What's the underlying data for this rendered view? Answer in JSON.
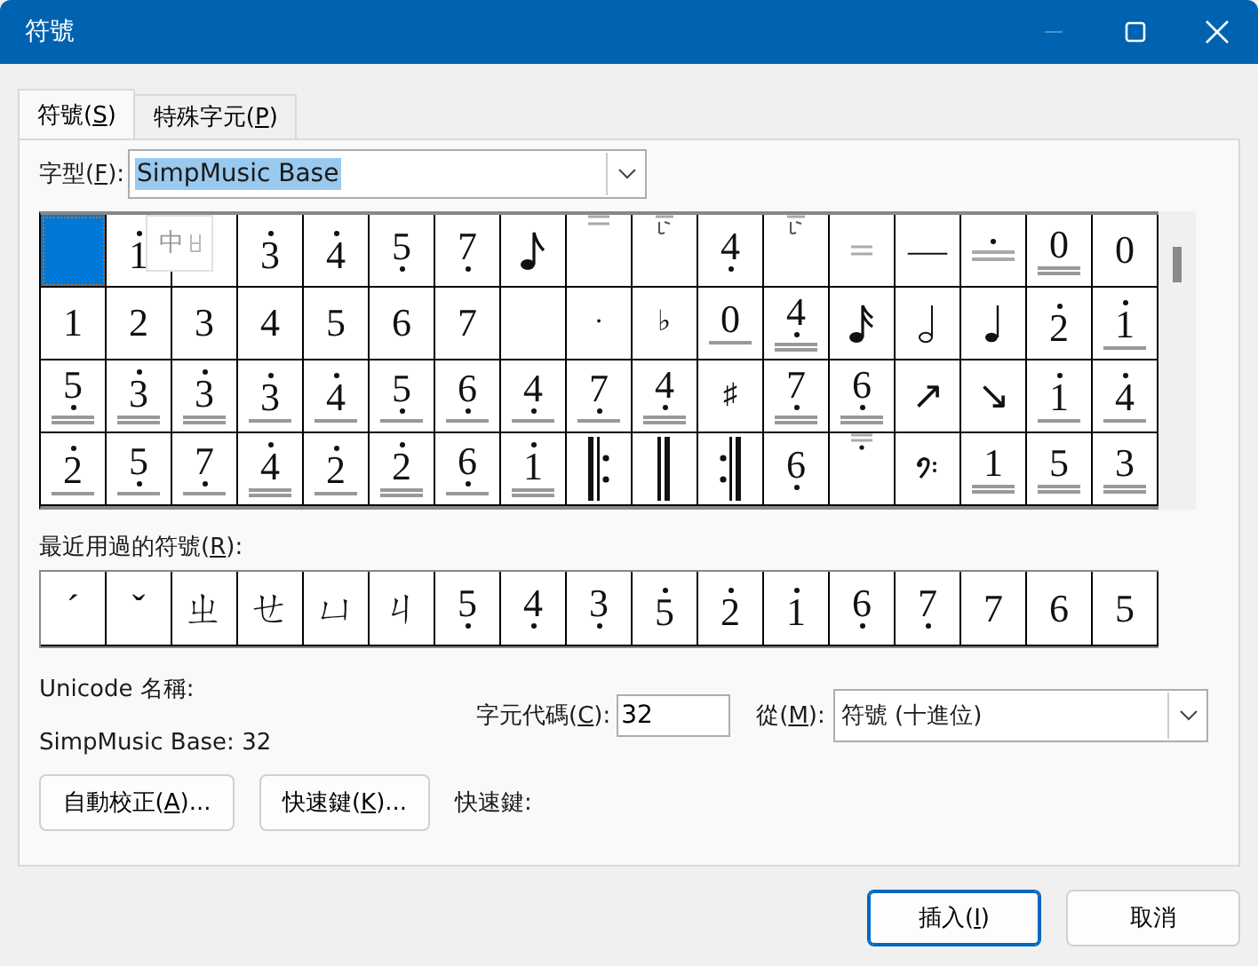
{
  "window": {
    "title": "符號"
  },
  "tabs": [
    {
      "before": "符號(",
      "key": "S",
      "after": ")",
      "selected": true
    },
    {
      "before": "特殊字元(",
      "key": "P",
      "after": ")",
      "selected": false
    }
  ],
  "font": {
    "before": "字型(",
    "key": "F",
    "after": "):",
    "value": "SimpMusic Base",
    "highlighted": true
  },
  "ime_indicator": {
    "text": "中"
  },
  "symbols": [
    {
      "kind": "blank",
      "selected": true
    },
    {
      "kind": "digit",
      "text": "1",
      "above": true,
      "below": false,
      "underline": false,
      "selected": false
    },
    {
      "kind": "blank",
      "selected": false
    },
    {
      "kind": "digit",
      "text": "3",
      "above": true,
      "below": false,
      "underline": false,
      "selected": false
    },
    {
      "kind": "digit",
      "text": "4",
      "above": true,
      "below": false,
      "underline": false,
      "selected": false
    },
    {
      "kind": "digit",
      "text": "5",
      "above": false,
      "below": true,
      "underline": false,
      "selected": false
    },
    {
      "kind": "digit",
      "text": "7",
      "above": false,
      "below": true,
      "underline": false,
      "selected": false
    },
    {
      "kind": "eighth-note",
      "selected": false
    },
    {
      "kind": "top-double",
      "selected": false
    },
    {
      "kind": "tie-mark",
      "selected": false
    },
    {
      "kind": "digit",
      "text": "4",
      "above": false,
      "below": true,
      "underline": false,
      "selected": false
    },
    {
      "kind": "tie-mark",
      "selected": false
    },
    {
      "kind": "bottom-double",
      "selected": false
    },
    {
      "kind": "glyph",
      "text": "—",
      "selected": false
    },
    {
      "kind": "dot-underline",
      "selected": false
    },
    {
      "kind": "digit",
      "text": "0",
      "above": false,
      "below": false,
      "underline": true,
      "double_line": true,
      "selected": false
    },
    {
      "kind": "digit",
      "text": "0",
      "above": false,
      "below": false,
      "underline": false,
      "selected": false
    },
    {
      "kind": "digit",
      "text": "1",
      "above": false,
      "below": false,
      "underline": false,
      "selected": false
    },
    {
      "kind": "digit",
      "text": "2",
      "above": false,
      "below": false,
      "underline": false,
      "selected": false
    },
    {
      "kind": "digit",
      "text": "3",
      "above": false,
      "below": false,
      "underline": false,
      "selected": false
    },
    {
      "kind": "digit",
      "text": "4",
      "above": false,
      "below": false,
      "underline": false,
      "selected": false
    },
    {
      "kind": "digit",
      "text": "5",
      "above": false,
      "below": false,
      "underline": false,
      "selected": false
    },
    {
      "kind": "digit",
      "text": "6",
      "above": false,
      "below": false,
      "underline": false,
      "selected": false
    },
    {
      "kind": "digit",
      "text": "7",
      "above": false,
      "below": false,
      "underline": false,
      "selected": false
    },
    {
      "kind": "blank",
      "selected": false
    },
    {
      "kind": "glyph",
      "text": "·",
      "selected": false
    },
    {
      "kind": "glyph",
      "text": "♭",
      "selected": false
    },
    {
      "kind": "digit",
      "text": "0",
      "above": false,
      "below": false,
      "underline": true,
      "double_line": false,
      "selected": false
    },
    {
      "kind": "digit",
      "text": "4",
      "above": false,
      "below": true,
      "underline": true,
      "double_line": true,
      "selected": false
    },
    {
      "kind": "sixteenth-note",
      "selected": false
    },
    {
      "kind": "half-note",
      "selected": false
    },
    {
      "kind": "quarter-note",
      "selected": false
    },
    {
      "kind": "digit",
      "text": "2",
      "above": true,
      "below": false,
      "underline": false,
      "selected": false
    },
    {
      "kind": "digit",
      "text": "1",
      "above": true,
      "below": false,
      "underline": true,
      "double_line": false,
      "selected": false
    },
    {
      "kind": "digit",
      "text": "5",
      "above": false,
      "below": true,
      "underline": true,
      "double_line": true,
      "selected": false
    },
    {
      "kind": "digit",
      "text": "3",
      "above": true,
      "below": false,
      "underline": true,
      "double_line": true,
      "selected": false
    },
    {
      "kind": "digit",
      "text": "3",
      "above": true,
      "below": false,
      "underline": true,
      "double_line": true,
      "selected": false
    },
    {
      "kind": "digit",
      "text": "3",
      "above": true,
      "below": false,
      "underline": true,
      "double_line": false,
      "selected": false
    },
    {
      "kind": "digit",
      "text": "4",
      "above": true,
      "below": false,
      "underline": true,
      "double_line": false,
      "selected": false
    },
    {
      "kind": "digit",
      "text": "5",
      "above": false,
      "below": true,
      "underline": true,
      "double_line": false,
      "selected": false
    },
    {
      "kind": "digit",
      "text": "6",
      "above": false,
      "below": true,
      "underline": true,
      "double_line": false,
      "selected": false
    },
    {
      "kind": "digit",
      "text": "4",
      "above": false,
      "below": true,
      "underline": true,
      "double_line": false,
      "selected": false
    },
    {
      "kind": "digit",
      "text": "7",
      "above": false,
      "below": true,
      "underline": true,
      "double_line": false,
      "selected": false
    },
    {
      "kind": "digit",
      "text": "4",
      "above": false,
      "below": true,
      "underline": true,
      "double_line": true,
      "selected": false
    },
    {
      "kind": "glyph",
      "text": "♯",
      "selected": false
    },
    {
      "kind": "digit",
      "text": "7",
      "above": false,
      "below": true,
      "underline": true,
      "double_line": true,
      "selected": false
    },
    {
      "kind": "digit",
      "text": "6",
      "above": false,
      "below": true,
      "underline": true,
      "double_line": true,
      "selected": false
    },
    {
      "kind": "glyph",
      "text": "↗",
      "selected": false
    },
    {
      "kind": "glyph",
      "text": "↘",
      "selected": false
    },
    {
      "kind": "digit",
      "text": "1",
      "above": true,
      "below": false,
      "underline": true,
      "double_line": false,
      "selected": false
    },
    {
      "kind": "digit",
      "text": "4",
      "above": true,
      "below": false,
      "underline": true,
      "double_line": false,
      "selected": false
    },
    {
      "kind": "digit",
      "text": "2",
      "above": true,
      "below": false,
      "underline": true,
      "double_line": false,
      "selected": false
    },
    {
      "kind": "digit",
      "text": "5",
      "above": false,
      "below": true,
      "underline": true,
      "double_line": false,
      "selected": false
    },
    {
      "kind": "digit",
      "text": "7",
      "above": false,
      "below": true,
      "underline": true,
      "double_line": false,
      "selected": false
    },
    {
      "kind": "digit",
      "text": "4",
      "above": true,
      "below": false,
      "underline": true,
      "double_line": true,
      "selected": false
    },
    {
      "kind": "digit",
      "text": "2",
      "above": true,
      "below": false,
      "underline": true,
      "double_line": false,
      "selected": false
    },
    {
      "kind": "digit",
      "text": "2",
      "above": true,
      "below": false,
      "underline": true,
      "double_line": true,
      "selected": false
    },
    {
      "kind": "digit",
      "text": "6",
      "above": false,
      "below": true,
      "underline": true,
      "double_line": false,
      "selected": false
    },
    {
      "kind": "digit",
      "text": "1",
      "above": true,
      "below": false,
      "underline": true,
      "double_line": true,
      "selected": false
    },
    {
      "kind": "repeat-start",
      "selected": false
    },
    {
      "kind": "double-bar",
      "selected": false
    },
    {
      "kind": "repeat-end",
      "selected": false
    },
    {
      "kind": "digit",
      "text": "6",
      "above": false,
      "below": true,
      "underline": false,
      "selected": false
    },
    {
      "kind": "top-double-dot",
      "selected": false
    },
    {
      "kind": "bass-clef",
      "selected": false
    },
    {
      "kind": "digit",
      "text": "1",
      "above": false,
      "below": false,
      "underline": true,
      "double_line": true,
      "selected": false
    },
    {
      "kind": "digit",
      "text": "5",
      "above": false,
      "below": false,
      "underline": true,
      "double_line": true,
      "selected": false
    },
    {
      "kind": "digit",
      "text": "3",
      "above": false,
      "below": false,
      "underline": true,
      "double_line": true,
      "selected": false
    }
  ],
  "recent": {
    "before": "最近用過的符號(",
    "key": "R",
    "after": "):",
    "items": [
      {
        "kind": "glyph",
        "text": "ˊ",
        "selected": false
      },
      {
        "kind": "glyph",
        "text": "ˇ",
        "selected": false
      },
      {
        "kind": "glyph",
        "text": "ㄓ",
        "selected": false
      },
      {
        "kind": "glyph",
        "text": "ㄝ",
        "selected": false
      },
      {
        "kind": "glyph",
        "text": "ㄩ",
        "selected": false
      },
      {
        "kind": "glyph",
        "text": "ㄐ",
        "selected": false
      },
      {
        "kind": "digit",
        "text": "5",
        "above": false,
        "below": true,
        "underline": false,
        "selected": false
      },
      {
        "kind": "digit",
        "text": "4",
        "above": false,
        "below": true,
        "underline": false,
        "selected": false
      },
      {
        "kind": "digit",
        "text": "3",
        "above": false,
        "below": true,
        "underline": false,
        "selected": false
      },
      {
        "kind": "digit",
        "text": "5",
        "above": true,
        "below": false,
        "underline": false,
        "selected": false
      },
      {
        "kind": "digit",
        "text": "2",
        "above": true,
        "below": false,
        "underline": false,
        "selected": false
      },
      {
        "kind": "digit",
        "text": "1",
        "above": true,
        "below": false,
        "underline": false,
        "selected": false
      },
      {
        "kind": "digit",
        "text": "6",
        "above": false,
        "below": true,
        "underline": false,
        "selected": false
      },
      {
        "kind": "digit",
        "text": "7",
        "above": false,
        "below": true,
        "underline": false,
        "selected": false
      },
      {
        "kind": "digit",
        "text": "7",
        "above": false,
        "below": false,
        "underline": false,
        "selected": false
      },
      {
        "kind": "digit",
        "text": "6",
        "above": false,
        "below": false,
        "underline": false,
        "selected": false
      },
      {
        "kind": "digit",
        "text": "5",
        "above": false,
        "below": false,
        "underline": false,
        "selected": false
      }
    ]
  },
  "unicode_name_label": "Unicode 名稱:",
  "unicode_name_value": "SimpMusic Base: 32",
  "char_code": {
    "before": "字元代碼(",
    "key": "C",
    "after": "):",
    "value": "32"
  },
  "from": {
    "before": "從(",
    "key": "M",
    "after": "):",
    "value": "符號 (十進位)"
  },
  "autocorrect_button": {
    "before": "自動校正(",
    "key": "A",
    "after": ")..."
  },
  "shortcut_button": {
    "before": "快速鍵(",
    "key": "K",
    "after": ")..."
  },
  "shortcut_label": "快速鍵:",
  "buttons": [
    {
      "before": "插入(",
      "key": "I",
      "after": ")",
      "default": true
    },
    {
      "before": "取消",
      "default": false
    }
  ]
}
